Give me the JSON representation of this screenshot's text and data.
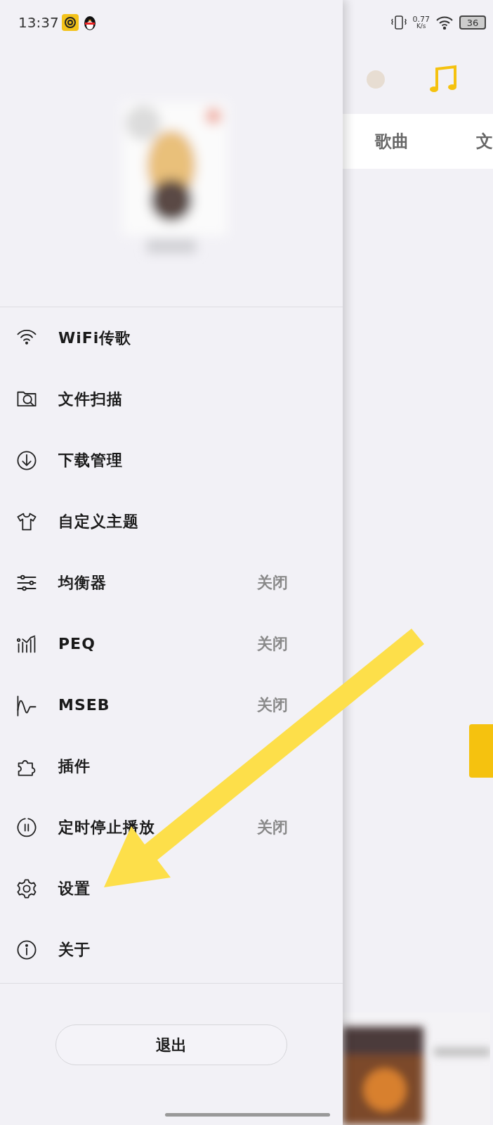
{
  "status_bar": {
    "time": "13:37",
    "net_speed": "0.77",
    "net_unit": "K/s",
    "battery": "36"
  },
  "drawer": {
    "menu": [
      {
        "label": "WiFi传歌"
      },
      {
        "label": "文件扫描"
      },
      {
        "label": "下载管理"
      },
      {
        "label": "自定义主题"
      },
      {
        "label": "均衡器",
        "value": "关闭"
      },
      {
        "label": "PEQ",
        "value": "关闭"
      },
      {
        "label": "MSEB",
        "value": "关闭"
      },
      {
        "label": "插件"
      },
      {
        "label": "定时停止播放",
        "value": "关闭"
      },
      {
        "label": "设置"
      },
      {
        "label": "关于"
      }
    ],
    "exit_button": "退出"
  },
  "main": {
    "tabs": [
      {
        "label": "歌曲"
      },
      {
        "label": "文"
      }
    ]
  }
}
